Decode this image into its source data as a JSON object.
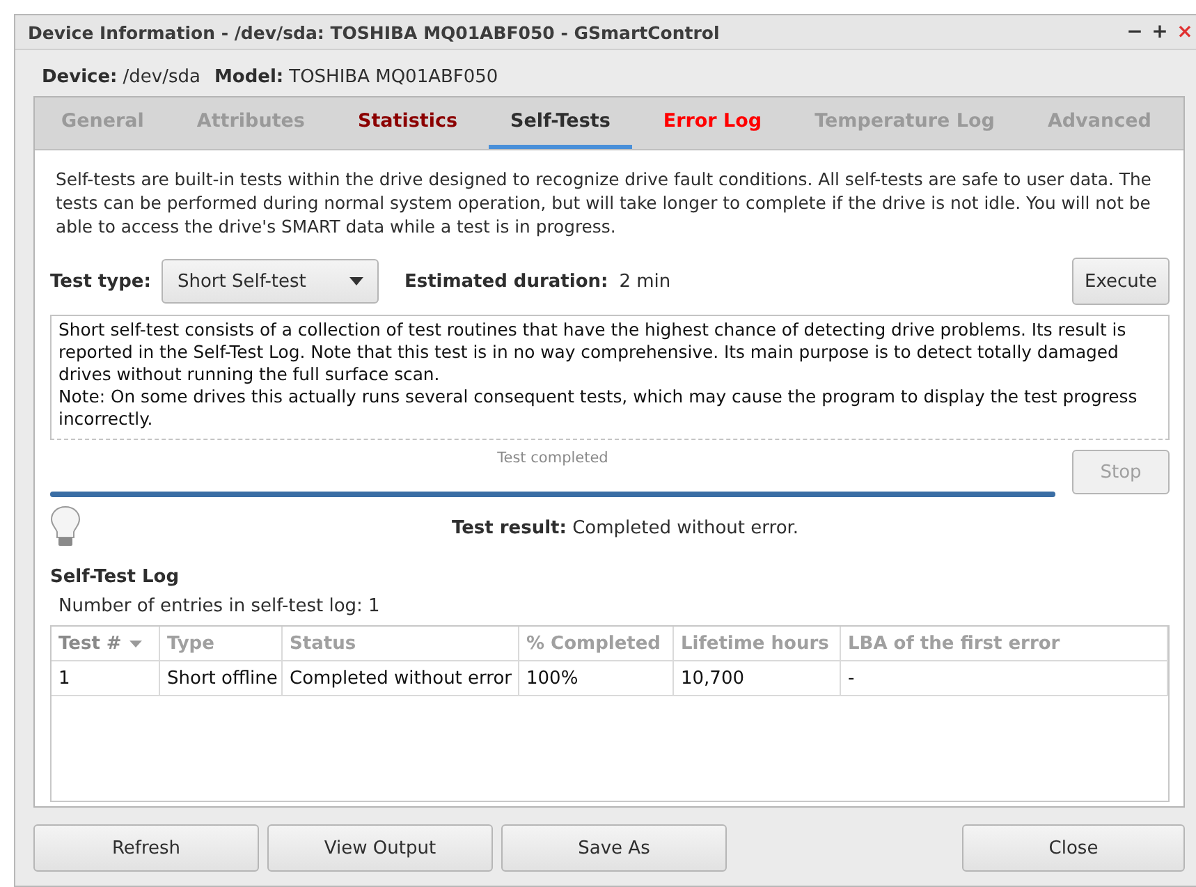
{
  "window": {
    "title": "Device Information - /dev/sda: TOSHIBA MQ01ABF050 - GSmartControl",
    "controls": [
      "−",
      "+",
      "×"
    ]
  },
  "device": {
    "device_label": "Device:",
    "device_value": "/dev/sda",
    "model_label": "Model:",
    "model_value": "TOSHIBA MQ01ABF050"
  },
  "tabs": [
    {
      "label": "General",
      "kind": "normal",
      "selected": false
    },
    {
      "label": "Attributes",
      "kind": "normal",
      "selected": false
    },
    {
      "label": "Statistics",
      "kind": "warning",
      "selected": false
    },
    {
      "label": "Self-Tests",
      "kind": "normal",
      "selected": true
    },
    {
      "label": "Error Log",
      "kind": "error",
      "selected": false
    },
    {
      "label": "Temperature Log",
      "kind": "normal",
      "selected": false
    },
    {
      "label": "Advanced",
      "kind": "normal",
      "selected": false
    }
  ],
  "intro": "Self-tests are built-in tests within the drive designed to recognize drive fault conditions. All self-tests are safe to user data. The tests can be performed during normal system operation, but will take longer to complete if the drive is not idle. You will not be able to access the drive's SMART data while a test is in progress.",
  "test_type": {
    "label": "Test type:",
    "value": "Short Self-test"
  },
  "duration": {
    "label": "Estimated duration:",
    "value": "2 min"
  },
  "execute_button": {
    "label": "Execute",
    "disabled": false
  },
  "description": [
    "Short self-test consists of a collection of test routines that have the highest chance of detecting drive problems. Its result is reported in the Self-Test Log. Note that this test is in no way comprehensive. Its main purpose is to detect totally damaged drives without running the full surface scan.",
    "Note: On some drives this actually runs several consequent tests, which may cause the program to display the test progress incorrectly."
  ],
  "progress": {
    "caption": "Test completed",
    "level": 1.0
  },
  "stop_button": {
    "label": "Stop",
    "disabled": true
  },
  "result": {
    "label": "Test result:",
    "value": "Completed without error."
  },
  "log": {
    "title": "Self-Test Log",
    "count": "Number of entries in self-test log: 1",
    "columns": [
      {
        "label": "Test #",
        "sorted": true
      },
      {
        "label": "Type",
        "sorted": false
      },
      {
        "label": "Status",
        "sorted": false
      },
      {
        "label": "% Completed",
        "sorted": false
      },
      {
        "label": "Lifetime hours",
        "sorted": false
      },
      {
        "label": "LBA of the first error",
        "sorted": false
      }
    ],
    "rows": [
      [
        "1",
        "Short offline",
        "Completed without error",
        "100%",
        "10,700",
        "-"
      ]
    ]
  },
  "buttons": [
    {
      "label": "Refresh",
      "kind": "left"
    },
    {
      "label": "View Output",
      "kind": "left"
    },
    {
      "label": "Save As",
      "kind": "left"
    },
    {
      "label": "Close",
      "kind": "right"
    }
  ]
}
